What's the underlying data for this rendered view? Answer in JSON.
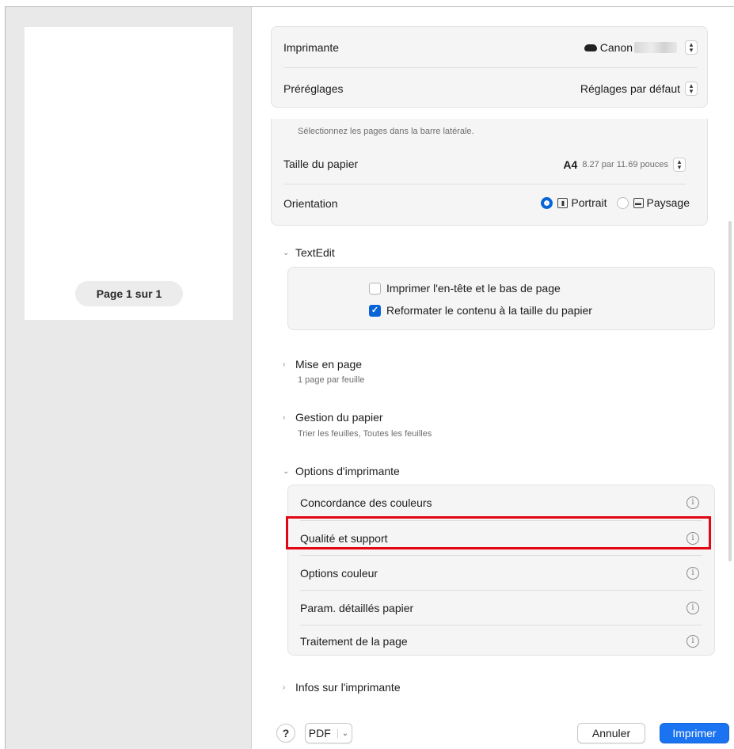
{
  "preview": {
    "page_indicator": "Page 1 sur 1"
  },
  "printer": {
    "label": "Imprimante",
    "value": "Canon"
  },
  "presets": {
    "label": "Préréglages",
    "value": "Réglages par défaut"
  },
  "pages_hint": "Sélectionnez les pages dans la barre latérale.",
  "paper_size": {
    "label": "Taille du papier",
    "value": "A4",
    "detail": "8.27 par 11.69 pouces"
  },
  "orientation": {
    "label": "Orientation",
    "portrait": "Portrait",
    "landscape": "Paysage",
    "selected": "portrait"
  },
  "textedit": {
    "title": "TextEdit",
    "options": [
      {
        "label": "Imprimer l'en-tête et le bas de page",
        "checked": false
      },
      {
        "label": "Reformater le contenu à la taille du papier",
        "checked": true
      }
    ]
  },
  "layout": {
    "title": "Mise en page",
    "subtitle": "1 page par feuille"
  },
  "paper_handling": {
    "title": "Gestion du papier",
    "subtitle": "Trier les feuilles, Toutes les feuilles"
  },
  "printer_options": {
    "title": "Options d'imprimante",
    "items": [
      "Concordance des couleurs",
      "Qualité et support",
      "Options couleur",
      "Param. détaillés papier",
      "Traitement de la page"
    ],
    "highlighted": "Qualité et support"
  },
  "printer_info": {
    "title": "Infos sur l'imprimante"
  },
  "footer": {
    "help": "?",
    "pdf": "PDF",
    "cancel": "Annuler",
    "print": "Imprimer"
  },
  "colors": {
    "accent": "#1a73f0",
    "highlight_border": "#e30613"
  }
}
